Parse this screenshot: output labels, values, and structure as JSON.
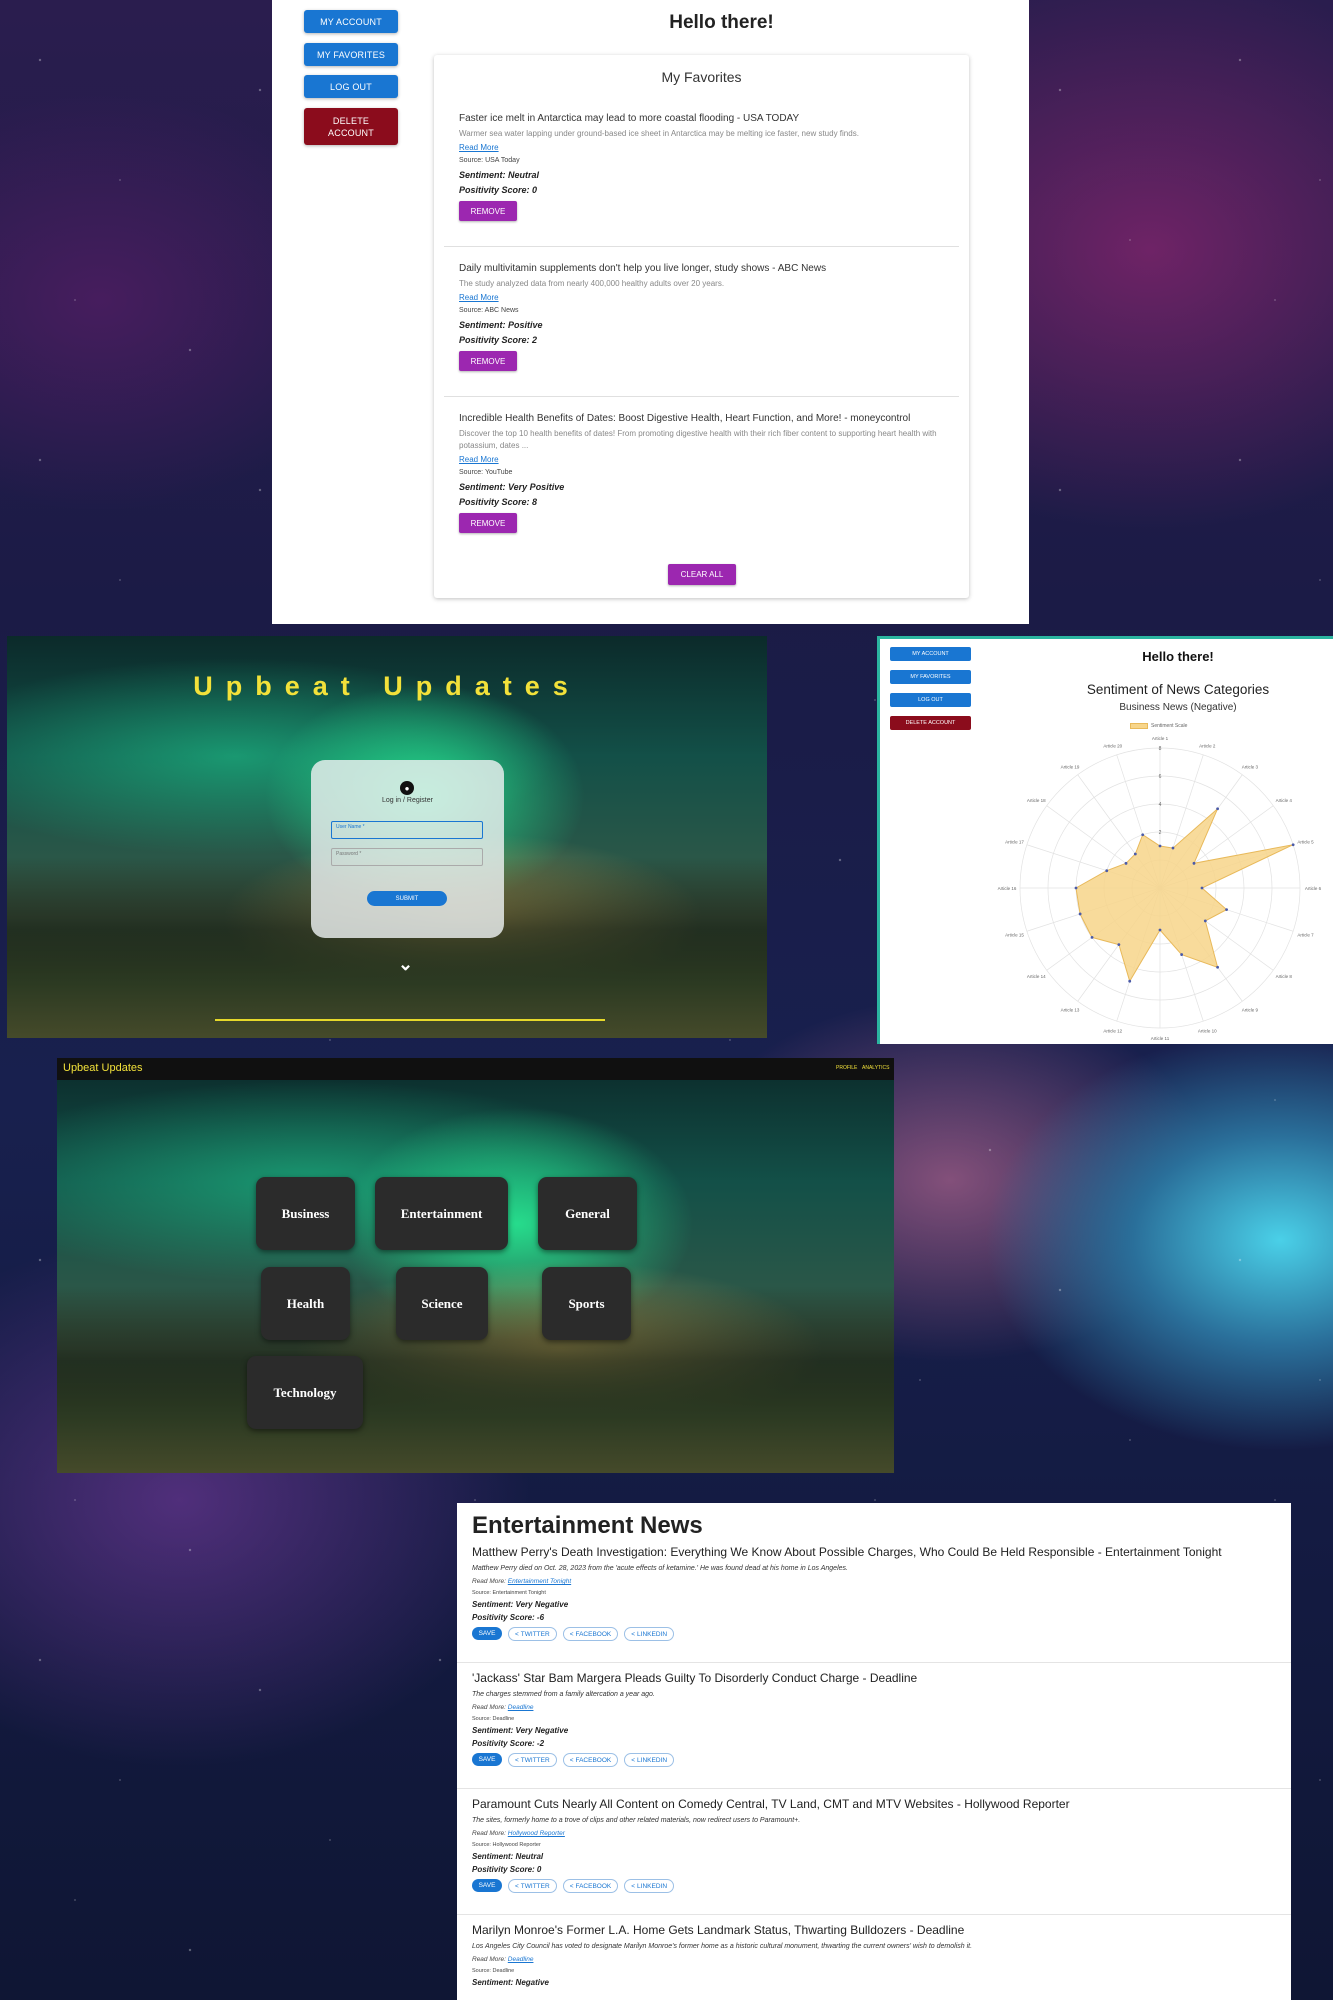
{
  "colors": {
    "primary": "#1976d2",
    "danger": "#8b0c1c",
    "purple": "#9c27b0",
    "brand_yellow": "#f2e13a",
    "radar_fill": "#f7d58a"
  },
  "favorites_panel": {
    "sidebar": [
      "MY ACCOUNT",
      "MY FAVORITES",
      "LOG OUT",
      "DELETE ACCOUNT"
    ],
    "greeting": "Hello there!",
    "card_title": "My Favorites",
    "items": [
      {
        "title": "Faster ice melt in Antarctica may lead to more coastal flooding - USA TODAY",
        "description": "Warmer sea water lapping under ground-based ice sheet in Antarctica may be melting ice faster, new study finds.",
        "read_more": "Read More",
        "source": "Source: USA Today",
        "sentiment": "Sentiment: Neutral",
        "score": "Positivity Score: 0",
        "remove": "REMOVE"
      },
      {
        "title": "Daily multivitamin supplements don't help you live longer, study shows - ABC News",
        "description": "The study analyzed data from nearly 400,000 healthy adults over 20 years.",
        "read_more": "Read More",
        "source": "Source: ABC News",
        "sentiment": "Sentiment: Positive",
        "score": "Positivity Score: 2",
        "remove": "REMOVE"
      },
      {
        "title": "Incredible Health Benefits of Dates: Boost Digestive Health, Heart Function, and More! - moneycontrol",
        "description": "Discover the top 10 health benefits of dates! From promoting digestive health with their rich fiber content to supporting heart health with potassium, dates ...",
        "read_more": "Read More",
        "source": "Source: YouTube",
        "sentiment": "Sentiment: Very Positive",
        "score": "Positivity Score: 8",
        "remove": "REMOVE"
      }
    ],
    "clear_all": "CLEAR ALL"
  },
  "login_panel": {
    "title": "Upbeat Updates",
    "avatar_icon": "user-icon",
    "heading": "Log in / Register",
    "username_label": "User Name *",
    "password_label": "Password *",
    "submit": "SUBMIT",
    "chevron_icon": "chevron-down-icon"
  },
  "radar_panel": {
    "sidebar": [
      "MY ACCOUNT",
      "MY FAVORITES",
      "LOG OUT",
      "DELETE ACCOUNT"
    ],
    "greeting": "Hello there!"
  },
  "chart_data": {
    "type": "radar",
    "title": "Sentiment of News Categories",
    "subtitle": "Business News (Negative)",
    "legend": [
      "Sentiment Scale"
    ],
    "legend_position": "top",
    "r_ticks": [
      "2",
      "4",
      "6",
      "8"
    ],
    "categories": [
      "Article 1",
      "Article 2",
      "Article 3",
      "Article 4",
      "Article 5",
      "Article 6",
      "Article 7",
      "Article 8",
      "Article 9",
      "Article 10",
      "Article 11",
      "Article 12",
      "Article 13",
      "Article 14",
      "Article 15",
      "Article 16",
      "Article 17",
      "Article 18",
      "Article 19",
      "Article 20"
    ],
    "series": [
      {
        "name": "Sentiment Scale",
        "values": [
          1,
          1,
          5,
          1,
          8,
          1,
          3,
          2,
          5,
          3,
          1,
          5,
          3,
          4,
          4,
          4,
          2,
          1,
          1,
          2
        ]
      }
    ],
    "rlim": [
      -2,
      8
    ]
  },
  "categories_panel": {
    "brand": "Upbeat Updates",
    "nav": [
      "PROFILE",
      "ANALYTICS"
    ],
    "tiles": [
      "Business",
      "Entertainment",
      "General",
      "Health",
      "Science",
      "Sports",
      "Technology"
    ]
  },
  "news_panel": {
    "title": "Entertainment News",
    "items": [
      {
        "title": "Matthew Perry's Death Investigation: Everything We Know About Possible Charges, Who Could Be Held Responsible - Entertainment Tonight",
        "description": "Matthew Perry died on Oct. 28, 2023 from the 'acute effects of ketamine.' He was found dead at his home in Los Angeles.",
        "read_more_label": "Read More:",
        "read_more_link": "Entertainment Tonight",
        "source": "Source: Entertainment Tonight",
        "sentiment": "Sentiment: Very Negative",
        "score": "Positivity Score: -6"
      },
      {
        "title": "'Jackass' Star Bam Margera Pleads Guilty To Disorderly Conduct Charge - Deadline",
        "description": "The charges stemmed from a family altercation a year ago.",
        "read_more_label": "Read More:",
        "read_more_link": "Deadline",
        "source": "Source: Deadline",
        "sentiment": "Sentiment: Very Negative",
        "score": "Positivity Score: -2"
      },
      {
        "title": "Paramount Cuts Nearly All Content on Comedy Central, TV Land, CMT and MTV Websites - Hollywood Reporter",
        "description": "The sites, formerly home to a trove of clips and other related materials, now redirect users to Paramount+.",
        "read_more_label": "Read More:",
        "read_more_link": "Hollywood Reporter",
        "source": "Source: Hollywood Reporter",
        "sentiment": "Sentiment: Neutral",
        "score": "Positivity Score: 0"
      },
      {
        "title": "Marilyn Monroe's Former L.A. Home Gets Landmark Status, Thwarting Bulldozers - Deadline",
        "description": "Los Angeles City Council has voted to designate Marilyn Monroe's former home as a historic cultural monument, thwarting the current owners' wish to demolish it.",
        "read_more_label": "Read More:",
        "read_more_link": "Deadline",
        "source": "Source: Deadline",
        "sentiment": "Sentiment: Negative",
        "score": ""
      }
    ],
    "save": "SAVE",
    "share": [
      "TWITTER",
      "FACEBOOK",
      "LINKEDIN"
    ],
    "share_icon": "share-icon"
  }
}
